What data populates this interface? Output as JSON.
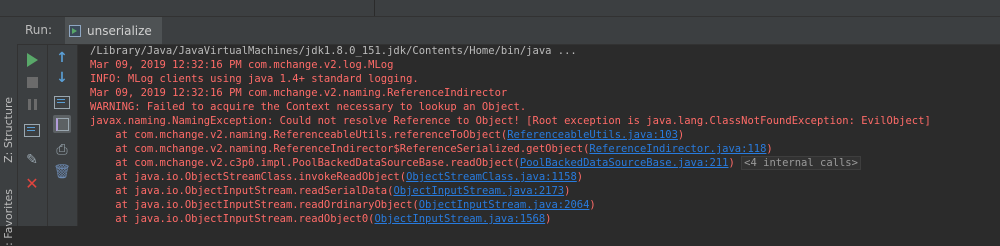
{
  "window": {
    "run_label": "Run:",
    "tab_title": "unserialize"
  },
  "sidebar": {
    "structure_label": "Z: Structure",
    "favorites_label": ": Favorites"
  },
  "console": {
    "lines": [
      {
        "text": "/Library/Java/JavaVirtualMachines/jdk1.8.0_151.jdk/Contents/Home/bin/java ..."
      },
      {
        "text": "Mar 09, 2019 12:32:16 PM com.mchange.v2.log.MLog"
      },
      {
        "text": "INFO: MLog clients using java 1.4+ standard logging."
      },
      {
        "text": "Mar 09, 2019 12:32:16 PM com.mchange.v2.naming.ReferenceIndirector"
      },
      {
        "text": "WARNING: Failed to acquire the Context necessary to lookup an Object."
      },
      {
        "text": "javax.naming.NamingException: Could not resolve Reference to Object! [Root exception is java.lang.ClassNotFoundException: EvilObject]"
      },
      {
        "prefix": "\tat com.mchange.v2.naming.ReferenceableUtils.referenceToObject(",
        "link": "ReferenceableUtils.java:103",
        "suffix": ")"
      },
      {
        "prefix": "\tat com.mchange.v2.naming.ReferenceIndirector$ReferenceSerialized.getObject(",
        "link": "ReferenceIndirector.java:118",
        "suffix": ")"
      },
      {
        "prefix": "\tat com.mchange.v2.c3p0.impl.PoolBackedDataSourceBase.readObject(",
        "link": "PoolBackedDataSourceBase.java:211",
        "suffix": ") ",
        "hint": "<4 internal calls>"
      },
      {
        "prefix": "\tat java.io.ObjectStreamClass.invokeReadObject(",
        "link": "ObjectStreamClass.java:1158",
        "suffix": ")"
      },
      {
        "prefix": "\tat java.io.ObjectInputStream.readSerialData(",
        "link": "ObjectInputStream.java:2173",
        "suffix": ")"
      },
      {
        "prefix": "\tat java.io.ObjectInputStream.readOrdinaryObject(",
        "link": "ObjectInputStream.java:2064",
        "suffix": ")"
      },
      {
        "prefix": "\tat java.io.ObjectInputStream.readObject0(",
        "link": "ObjectInputStream.java:1568",
        "suffix": ")"
      }
    ]
  },
  "colors": {
    "stdout": "#bbbbbb",
    "stderr": "#ff6b68",
    "link": "#287bde",
    "run_green": "#59a869"
  },
  "icons": {
    "toolbar_left": [
      "rerun-icon",
      "stop-icon",
      "pause-icon",
      "dump-threads-icon",
      "pin-tab-icon",
      "close-icon"
    ],
    "toolbar_right": [
      "scroll-up-icon",
      "scroll-down-icon",
      "soft-wrap-icon",
      "scroll-to-end-icon",
      "print-icon",
      "clear-all-icon"
    ]
  }
}
